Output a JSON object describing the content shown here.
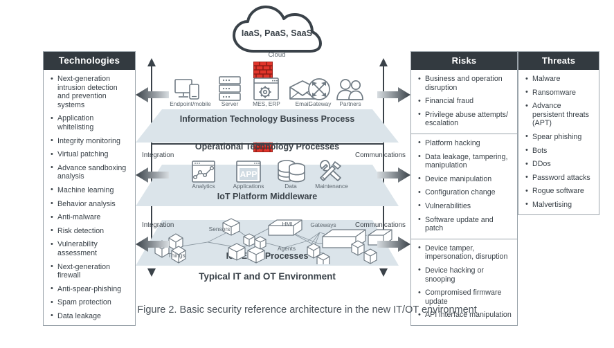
{
  "figure": {
    "caption": "Figure 2. Basic security reference architecture in the new IT/OT environment"
  },
  "colors": {
    "header_bg": "#333a40",
    "panel_border": "#9aa3aa",
    "layer_band": "#dbe4ea",
    "firewall_red": "#e2352b",
    "arrow_dark": "#3a4249",
    "text": "#3a4249"
  },
  "cloud": {
    "label": "IaaS, PaaS, SaaS",
    "caption": "Cloud"
  },
  "technologies": {
    "title": "Technologies",
    "items": [
      "Next-generation intrusion detection and prevention systems",
      "Application whitelisting",
      "Integrity monitoring",
      "Virtual patching",
      "Advance sandboxing analysis",
      "Machine learning",
      "Behavior analysis",
      "Anti-malware",
      "Risk detection",
      "Vulnerability assessment",
      "Next-generation firewall",
      "Anti-spear-phishing",
      "Spam protection",
      "Data leakage"
    ]
  },
  "risks": {
    "title": "Risks",
    "sections": [
      {
        "items": [
          "Business and operation disruption",
          "Financial fraud",
          "Privilege abuse attempts/ escalation"
        ]
      },
      {
        "items": [
          "Platform hacking",
          "Data leakage, tampering, manipulation",
          "Device manipulation",
          "Configuration change",
          "Vulnerabilities",
          "Software update and patch"
        ]
      },
      {
        "items": [
          "Device tamper, impersonation, disruption",
          "Device hacking or snooping",
          "Compromised firmware update",
          "API interface manipulation"
        ]
      }
    ]
  },
  "threats": {
    "title": "Threats",
    "items": [
      "Malware",
      "Ransomware",
      "Advance persistent threats (APT)",
      "Spear phishing",
      "Bots",
      "DDos",
      "Password attacks",
      "Rogue software",
      "Malvertising"
    ]
  },
  "layers": [
    {
      "id": "it",
      "title": "Information Technology Business Process",
      "icons": [
        {
          "name": "endpoint-mobile-icon",
          "label": "Endpoint/mobile"
        },
        {
          "name": "server-icon",
          "label": "Server"
        },
        {
          "name": "mes-erp-icon",
          "label": "MES, ERP"
        },
        {
          "name": "email-icon",
          "label": "Email"
        },
        {
          "name": "gateway-icon",
          "label": "Gateway"
        },
        {
          "name": "partners-icon",
          "label": "Partners"
        }
      ]
    },
    {
      "id": "ot",
      "title": "IoT Platform Middleware",
      "band_title": "Operational Technology Processes",
      "icons": [
        {
          "name": "analytics-icon",
          "label": "Analytics"
        },
        {
          "name": "applications-icon",
          "label": "Applications"
        },
        {
          "name": "data-icon",
          "label": "Data"
        },
        {
          "name": "maintenance-icon",
          "label": "Maintenance"
        }
      ]
    },
    {
      "id": "edge",
      "title": "IoT Edge Processes",
      "node_labels": [
        "Things",
        "Sensors",
        "HMI",
        "Agents",
        "Gateways"
      ]
    }
  ],
  "bottom_title": "Typical IT and OT Environment",
  "side_labels": {
    "integration_top": "Integration",
    "integration_bottom": "Integration",
    "communications_top": "Communications",
    "communications_bottom": "Communications"
  },
  "app_icon_text": "APP"
}
